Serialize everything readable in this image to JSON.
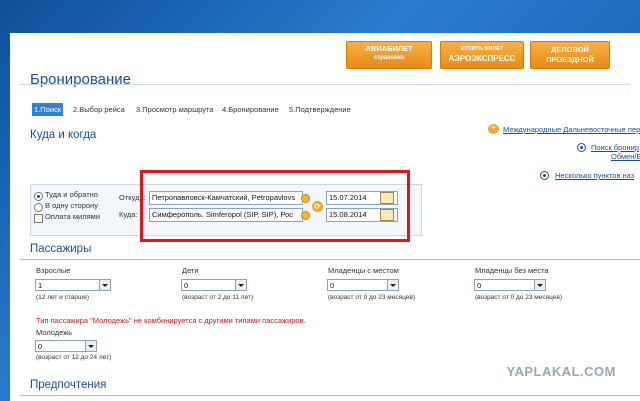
{
  "header_buttons": [
    {
      "line1": "АВИАБИЛЕТ",
      "line2": "страховка"
    },
    {
      "line1": "КУПИТЬ БИЛЕТ",
      "line2": "АЭРОЭКСПРЕСС"
    },
    {
      "line1": "ДЕЛОВОЙ",
      "line2": "ПРОЕЗДНОЙ"
    }
  ],
  "page_title": "Бронирование",
  "steps": [
    "1.Поиск",
    "2.Выбор рейса",
    "3.Просмотр маршрута",
    "4.Бронирование",
    "5.Подтверждение"
  ],
  "where_when": {
    "heading": "Куда и когда",
    "links": [
      "Международные Дальневосточные пер",
      "Поиск бронир",
      "Обмен/Е",
      "Несколько пунктов наз"
    ],
    "trip_options": [
      "Туда и обратно",
      "В одну сторону",
      "Оплата милями"
    ],
    "from_label": "Откуда:",
    "from_value": "Петропавловск-Камчатский, Petropavlovs",
    "to_label": "Куда:",
    "to_value": "Симферополь, Simferopol (SIP, SIP), Рос",
    "depart_date": "15.07.2014",
    "return_date": "15.08.2014"
  },
  "passengers": {
    "heading": "Пассажиры",
    "groups": [
      {
        "label": "Взрослые",
        "value": "1",
        "note": "(12 лет и старше)"
      },
      {
        "label": "Дети",
        "value": "0",
        "note": "(возраст от 2 до 11 лет)"
      },
      {
        "label": "Младенцы с местом",
        "value": "0",
        "note": "(возраст от 0 до 23 месяцев)"
      },
      {
        "label": "Младенцы без места",
        "value": "0",
        "note": "(возраст от 0 до 23 месяцев)"
      }
    ],
    "warning": "Тип пассажира \"Молодежь\" не комбинируется с другими типами пассажиров.",
    "youth": {
      "label": "Молодежь",
      "value": "0",
      "note": "(возраст от 12 до 24 лет)"
    }
  },
  "preferences": {
    "heading": "Предпочтения"
  },
  "watermark": "YAPLAKAL.COM",
  "colors": {
    "accent": "#1b4f91",
    "orange": "#f0a52b",
    "highlight": "#e0151c"
  }
}
